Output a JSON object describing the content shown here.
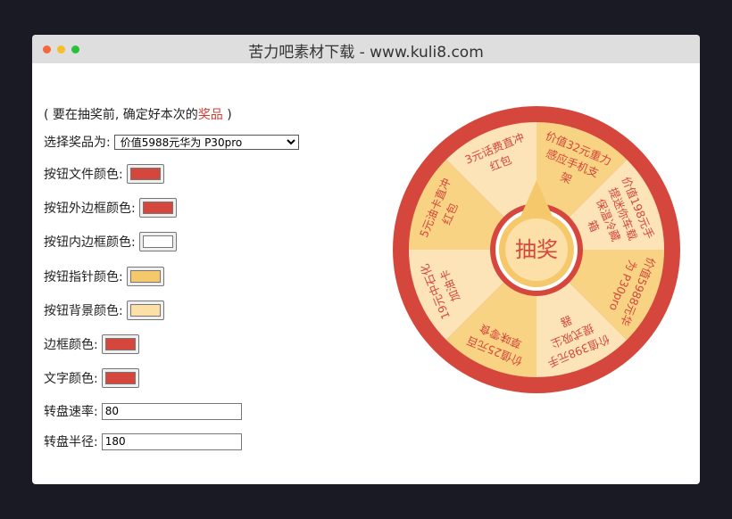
{
  "window": {
    "title": "苦力吧素材下载 - www.kuli8.com"
  },
  "note": {
    "prefix": "( 要在抽奖前, 确定好本次的",
    "highlight": "奖品",
    "suffix": " )"
  },
  "form": {
    "prize_label": "选择奖品为:",
    "prize_selected": "价值5988元华为 P30pro",
    "button_text_color_label": "按钮文件颜色:",
    "button_text_color": "#d5473c",
    "button_outer_border_label": "按钮外边框颜色:",
    "button_outer_border_color": "#d5473c",
    "button_inner_border_label": "按钮内边框颜色:",
    "button_inner_border_color": "#ffffff",
    "button_pointer_label": "按钮指针颜色:",
    "button_pointer_color": "#f6c86c",
    "button_bg_label": "按钮背景颜色:",
    "button_bg_color": "#fde0a8",
    "border_color_label": "边框颜色:",
    "border_color": "#d5473c",
    "text_color_label": "文字颜色:",
    "text_color": "#d5473c",
    "speed_label": "转盘速率:",
    "speed_value": "80",
    "radius_label": "转盘半径:",
    "radius_value": "180"
  },
  "wheel": {
    "button_label": "抽奖",
    "rim_color": "#d5473c",
    "segment_colors": [
      "#f9d384",
      "#fce4b8"
    ],
    "text_color": "#d5473c",
    "prizes": [
      {
        "lines": [
          "价值32元重力",
          "感应手机支",
          "架"
        ]
      },
      {
        "lines": [
          "价值198元手",
          "提迷你车载",
          "保温冷藏",
          "箱"
        ]
      },
      {
        "lines": [
          "价值5988元华",
          "为 P30pro"
        ]
      },
      {
        "lines": [
          "价值398元手",
          "提式吸尘",
          "器"
        ]
      },
      {
        "lines": [
          "价值25元百",
          "草味零食"
        ]
      },
      {
        "lines": [
          "19元中石化",
          "加油卡"
        ]
      },
      {
        "lines": [
          "5元油卡直冲",
          "红包"
        ]
      },
      {
        "lines": [
          "3元话费直冲",
          "红包"
        ]
      }
    ]
  }
}
